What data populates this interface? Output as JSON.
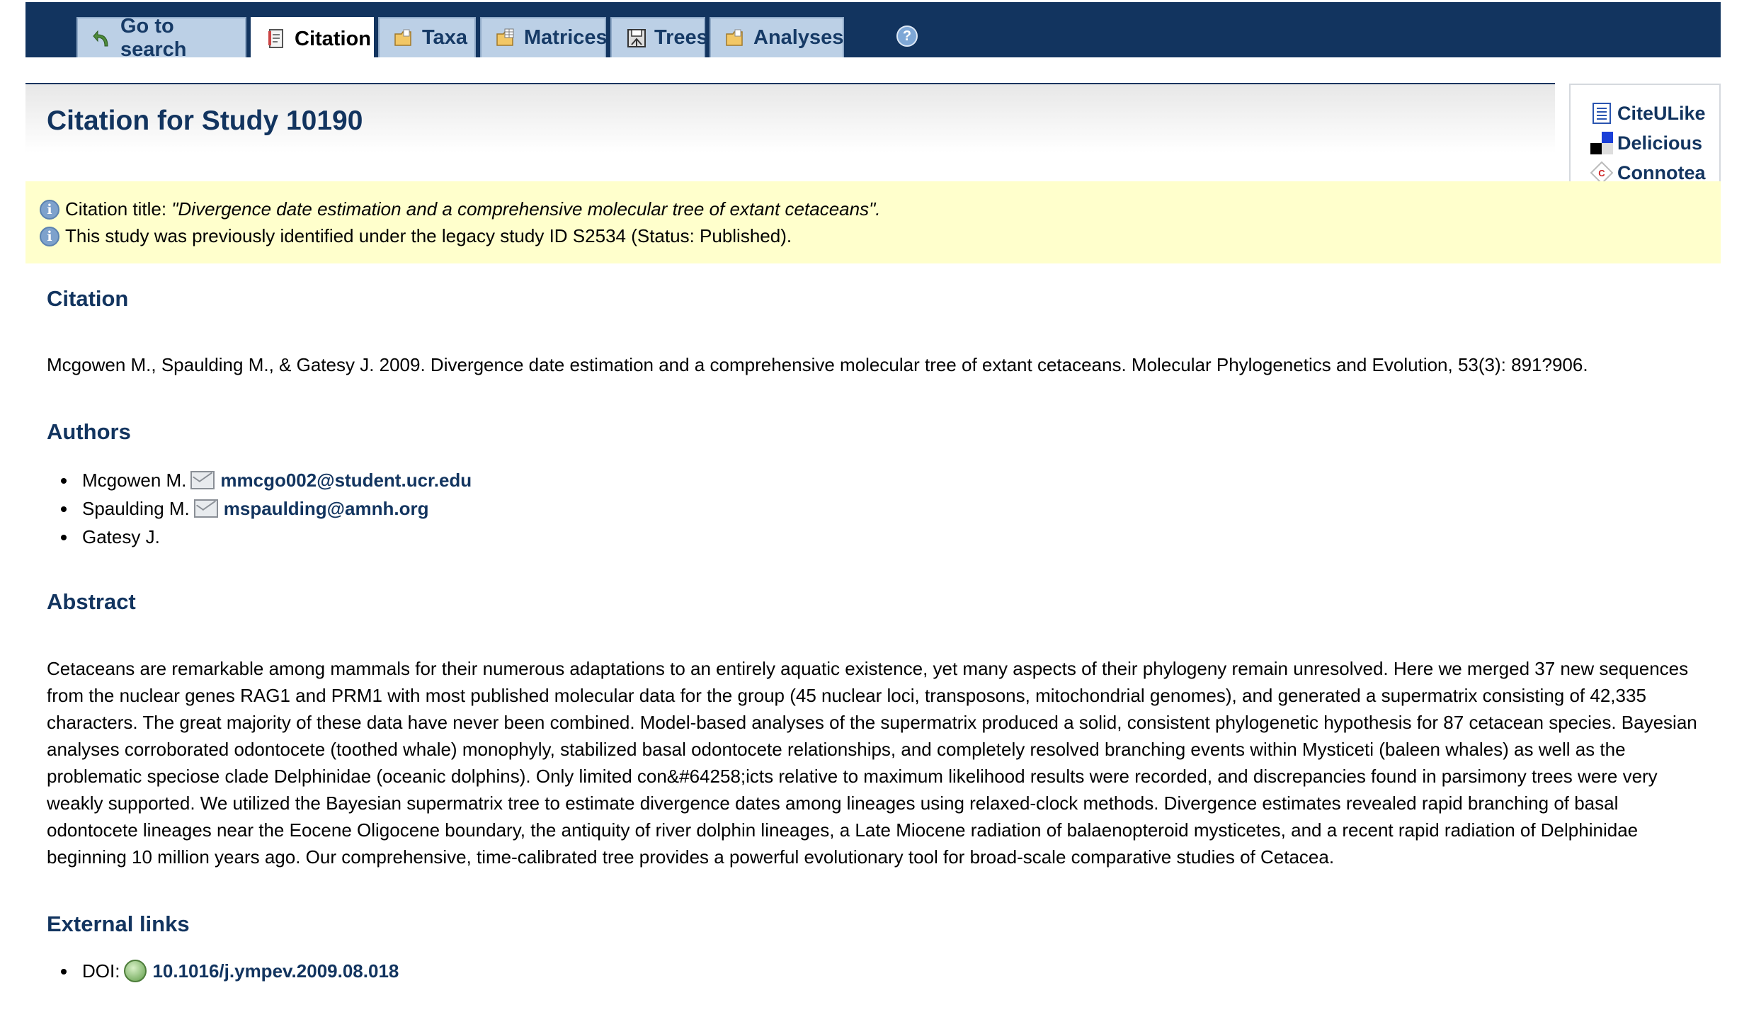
{
  "nav": {
    "tabs": [
      {
        "label": "Go to search",
        "icon": "back-arrow-icon"
      },
      {
        "label": "Citation",
        "icon": "document-icon",
        "active": true
      },
      {
        "label": "Taxa",
        "icon": "folder-icon"
      },
      {
        "label": "Matrices",
        "icon": "matrix-folder-icon"
      },
      {
        "label": "Trees",
        "icon": "tree-save-icon"
      },
      {
        "label": "Analyses",
        "icon": "folder-icon"
      }
    ],
    "help_icon": "help-icon",
    "help_glyph": "?"
  },
  "header": {
    "title": "Citation for Study 10190"
  },
  "social": {
    "links": [
      {
        "label": "CiteULike",
        "icon": "citeulike-icon"
      },
      {
        "label": "Delicious",
        "icon": "delicious-icon"
      },
      {
        "label": "Connotea",
        "icon": "connotea-icon"
      }
    ]
  },
  "info": {
    "icon_glyph": "i",
    "title_prefix": "Citation title: ",
    "title_value": "\"Divergence date estimation and a comprehensive molecular tree of extant cetaceans\".",
    "legacy": "This study was previously identified under the legacy study ID S2534 (Status: Published)."
  },
  "citation": {
    "heading": "Citation",
    "text": "Mcgowen M., Spaulding M., & Gatesy J. 2009. Divergence date estimation and a comprehensive molecular tree of extant cetaceans. Molecular Phylogenetics and Evolution, 53(3): 891?906."
  },
  "authors": {
    "heading": "Authors",
    "items": [
      {
        "name": "Mcgowen M.",
        "email": "mmcgo002@student.ucr.edu"
      },
      {
        "name": "Spaulding M.",
        "email": "mspaulding@amnh.org"
      },
      {
        "name": "Gatesy J.",
        "email": ""
      }
    ]
  },
  "abstract": {
    "heading": "Abstract",
    "text": "Cetaceans are remarkable among mammals for their numerous adaptations to an entirely aquatic existence, yet many aspects of their phylogeny remain unresolved. Here we merged 37 new sequences from the nuclear genes RAG1 and PRM1 with most published molecular data for the group (45 nuclear loci, transposons, mitochondrial genomes), and generated a supermatrix consisting of 42,335 characters. The great majority of these data have never been combined. Model-based analyses of the supermatrix produced a solid, consistent phylogenetic hypothesis for 87 cetacean species. Bayesian analyses corroborated odontocete (toothed whale) monophyly, stabilized basal odontocete relationships, and completely resolved branching events within Mysticeti (baleen whales) as well as the problematic speciose clade Delphinidae (oceanic dolphins). Only limited con&#64258;icts relative to maximum likelihood results were recorded, and discrepancies found in parsimony trees were very weakly supported. We utilized the Bayesian supermatrix tree to estimate divergence dates among lineages using relaxed-clock methods. Divergence estimates revealed rapid branching of basal odontocete lineages near the Eocene Oligocene boundary, the antiquity of river dolphin lineages, a Late Miocene radiation of balaenopteroid mysticetes, and a recent rapid radiation of Delphinidae beginning 10 million years ago. Our comprehensive, time-calibrated tree provides a powerful evolutionary tool for broad-scale comparative studies of Cetacea."
  },
  "external": {
    "heading": "External links",
    "doi_label": "DOI:",
    "doi_value": "10.1016/j.ympev.2009.08.018"
  },
  "colors": {
    "navbar": "#12345f",
    "heading": "#12345f",
    "info_band": "#ffffcc",
    "tab": "#bcd0e6"
  }
}
